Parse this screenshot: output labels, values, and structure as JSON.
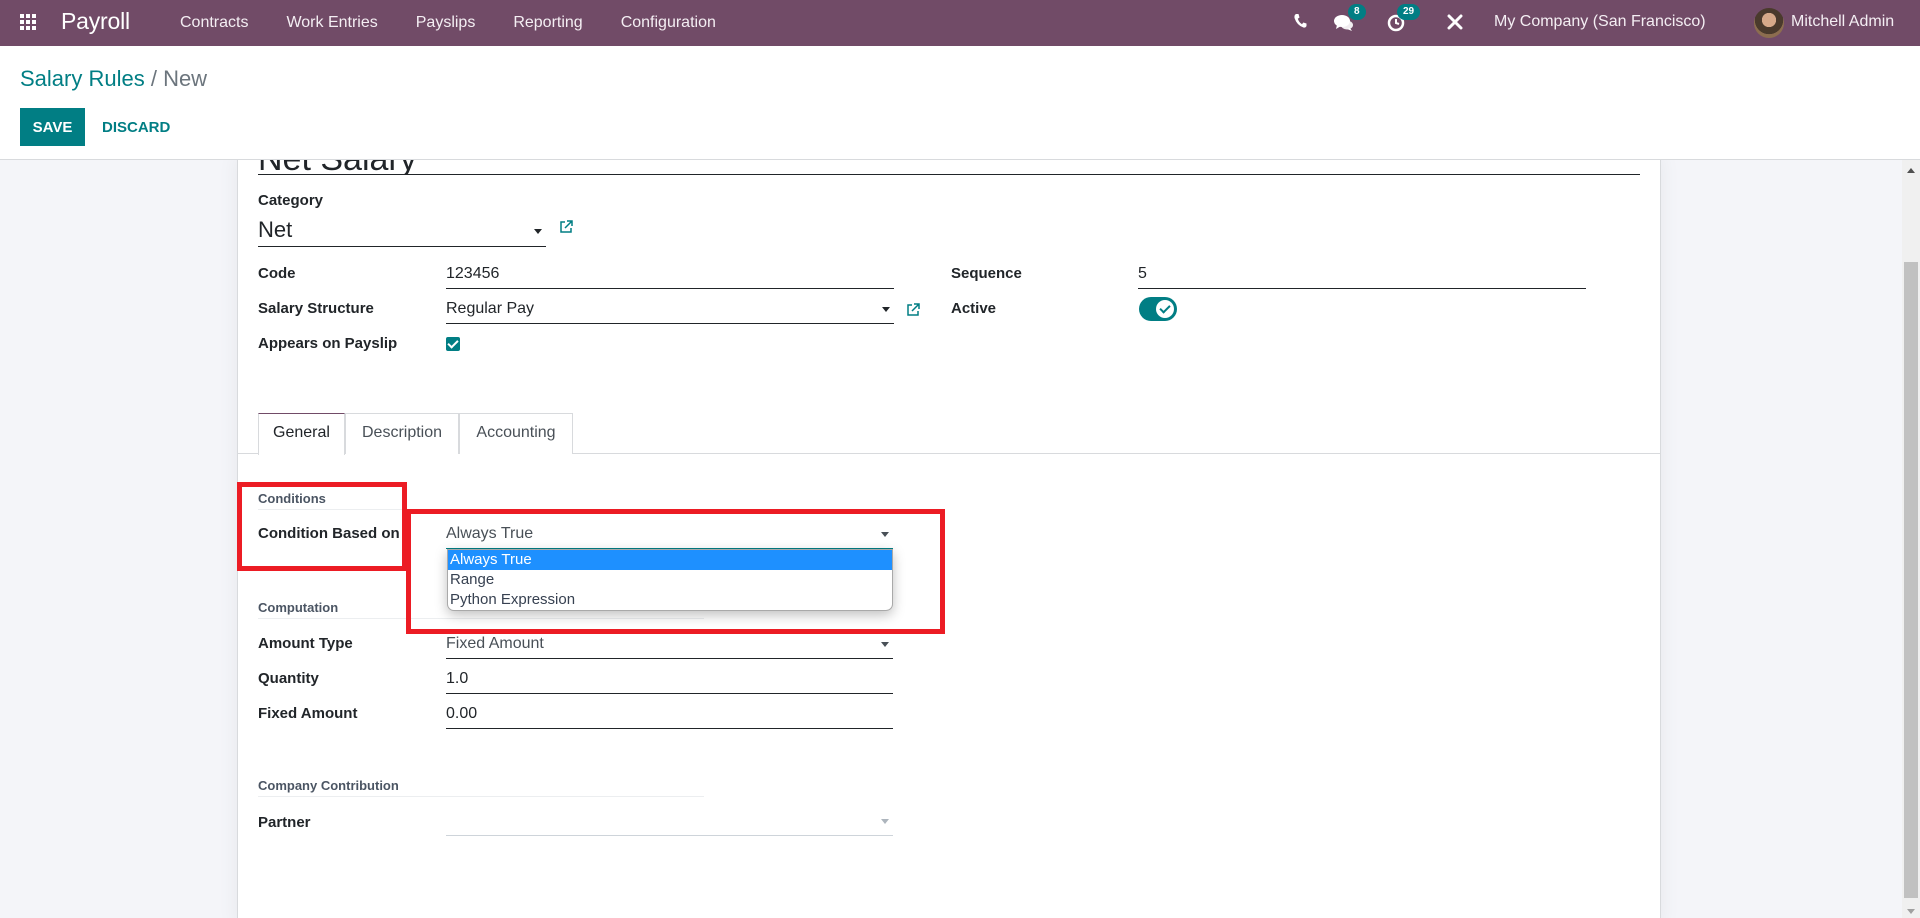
{
  "navbar": {
    "app_name": "Payroll",
    "menu": [
      "Contracts",
      "Work Entries",
      "Payslips",
      "Reporting",
      "Configuration"
    ],
    "icons": {
      "apps": "apps-grid-icon",
      "phone": "phone-icon",
      "messages": "chat-bubbles-icon",
      "activities": "clock-icon",
      "debug": "tools-icon"
    },
    "messages_badge": "8",
    "activities_badge": "29",
    "company": "My Company (San Francisco)",
    "user": "Mitchell Admin",
    "brand_color": "#714b67"
  },
  "control_panel": {
    "breadcrumb_parent": "Salary Rules",
    "breadcrumb_sep": " / ",
    "breadcrumb_current": "New",
    "save_label": "SAVE",
    "discard_label": "DISCARD",
    "accent_color": "#017e84"
  },
  "form": {
    "name": "Net Salary",
    "category_label": "Category",
    "category_value": "Net",
    "code_label": "Code",
    "code_value": "123456",
    "structure_label": "Salary Structure",
    "structure_value": "Regular Pay",
    "appears_label": "Appears on Payslip",
    "appears_checked": true,
    "sequence_label": "Sequence",
    "sequence_value": "5",
    "active_label": "Active",
    "active_on": true,
    "tabs": [
      "General",
      "Description",
      "Accounting"
    ],
    "active_tab": "General",
    "conditions": {
      "section_title": "Conditions",
      "condition_label": "Condition Based on",
      "condition_value": "Always True",
      "options": [
        "Always True",
        "Range",
        "Python Expression"
      ],
      "selected_option": "Always True"
    },
    "computation": {
      "section_title": "Computation",
      "amount_type_label": "Amount Type",
      "amount_type_value": "Fixed Amount",
      "quantity_label": "Quantity",
      "quantity_value": "1.0",
      "fixed_amount_label": "Fixed Amount",
      "fixed_amount_value": "0.00"
    },
    "contribution": {
      "section_title": "Company Contribution",
      "partner_label": "Partner",
      "partner_value": ""
    }
  },
  "annotation": {
    "highlight_color": "#ec1c24"
  }
}
